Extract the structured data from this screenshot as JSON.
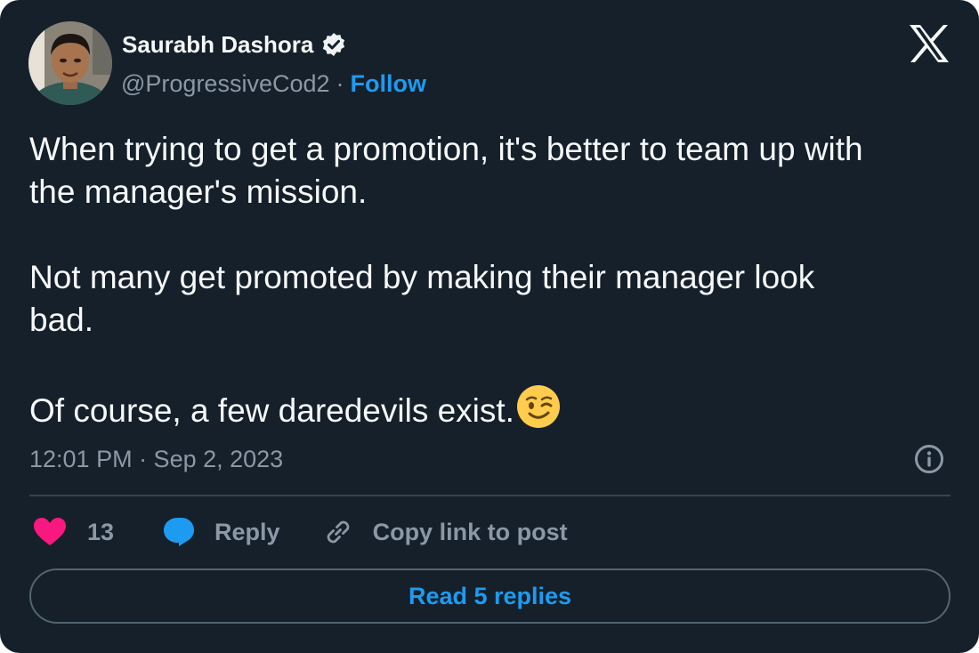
{
  "author": {
    "name": "Saurabh Dashora",
    "handle": "@ProgressiveCod2",
    "separator": "·",
    "follow_label": "Follow",
    "verified": true
  },
  "logo": "x-logo",
  "tweet": {
    "text": "When trying to get a promotion, it's better to team up with\nthe manager's mission.\n\nNot many get promoted by making their manager look\nbad.\n\nOf course, a few daredevils exist.",
    "emoji": "winking-face-emoji",
    "timestamp": "12:01 PM · Sep 2, 2023"
  },
  "actions": {
    "like_count": "13",
    "reply_label": "Reply",
    "copy_label": "Copy link to post"
  },
  "read_replies_label": "Read 5 replies",
  "colors": {
    "background": "#15202b",
    "text": "#f7f9f9",
    "secondary": "#8b98a5",
    "accent": "#1d9bf0",
    "like": "#f91880",
    "emoji": "#ffcc4d"
  }
}
